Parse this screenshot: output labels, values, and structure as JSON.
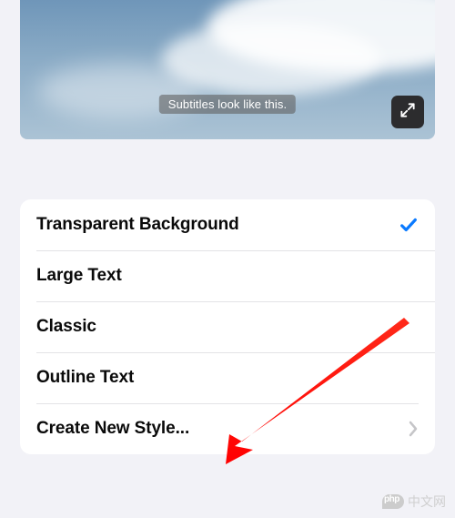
{
  "preview": {
    "subtitle_text": "Subtitles look like this."
  },
  "icons": {
    "expand_name": "expand-icon",
    "check_name": "checkmark-icon",
    "chevron_name": "chevron-right-icon"
  },
  "styles": {
    "items": [
      {
        "label": "Transparent Background",
        "selected": true
      },
      {
        "label": "Large Text",
        "selected": false
      },
      {
        "label": "Classic",
        "selected": false
      },
      {
        "label": "Outline Text",
        "selected": false
      }
    ],
    "create_label": "Create New Style..."
  },
  "colors": {
    "accent": "#0a7aff"
  },
  "watermark": {
    "text": "中文网"
  }
}
